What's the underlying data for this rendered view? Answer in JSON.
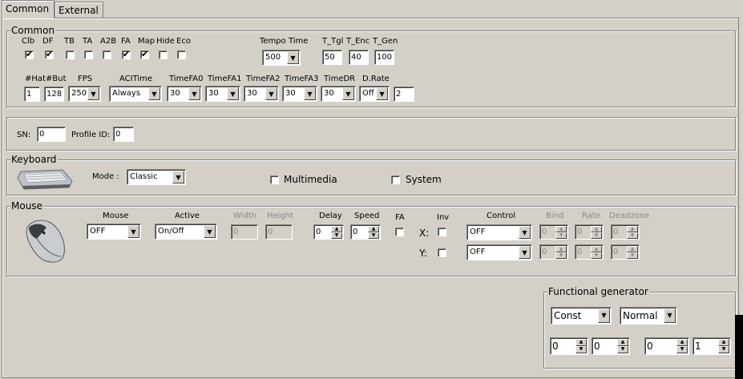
{
  "tabs": [
    {
      "label": "Common"
    },
    {
      "label": "External"
    }
  ],
  "common": {
    "legend": "Common",
    "checks": [
      {
        "label": "Clb",
        "checked": true
      },
      {
        "label": "DF",
        "checked": true
      },
      {
        "label": "TB",
        "checked": false
      },
      {
        "label": "TA",
        "checked": false
      },
      {
        "label": "A2B",
        "checked": false
      },
      {
        "label": "FA",
        "checked": true
      },
      {
        "label": "Map",
        "checked": true
      },
      {
        "label": "Hide",
        "checked": false
      },
      {
        "label": "Eco",
        "checked": false
      }
    ],
    "tempo_time_label": "Tempo Time",
    "tempo_time_value": "500",
    "t_tgl_label": "T_Tgl",
    "t_tgl_value": "50",
    "t_enc_label": "T_Enc",
    "t_enc_value": "40",
    "t_gen_label": "T_Gen",
    "t_gen_value": "100",
    "hat_label": "#Hat",
    "hat_value": "1",
    "but_label": "#But",
    "but_value": "128",
    "fps_label": "FPS",
    "fps_value": "250",
    "acitime_label": "ACITime",
    "acitime_value": "Always",
    "timefa0_label": "TimeFA0",
    "timefa0_value": "30",
    "timefa1_label": "TimeFA1",
    "timefa1_value": "30",
    "timefa2_label": "TimeFA2",
    "timefa2_value": "30",
    "timefa3_label": "TimeFA3",
    "timefa3_value": "30",
    "timedr_label": "TimeDR",
    "timedr_value": "30",
    "drate_label": "D.Rate",
    "drate_value": "Off",
    "drate_num": "2"
  },
  "sn": {
    "sn_label": "SN:",
    "sn_value": "0",
    "profile_label": "Profile ID:",
    "profile_value": "0"
  },
  "keyboard": {
    "legend": "Keyboard",
    "mode_label": "Mode :",
    "mode_value": "Classic",
    "multimedia_label": "Multimedia",
    "system_label": "System"
  },
  "mouse": {
    "legend": "Mouse",
    "mouse_label": "Mouse",
    "mouse_value": "OFF",
    "active_label": "Active",
    "active_value": "On/Off",
    "width_label": "Width",
    "width_value": "0",
    "height_label": "Height",
    "height_value": "0",
    "delay_label": "Delay",
    "delay_value": "0",
    "speed_label": "Speed",
    "speed_value": "0",
    "fa_label": "FA",
    "inv_label": "Inv",
    "x_label": "X:",
    "y_label": "Y:",
    "control_label": "Control",
    "control_x": "OFF",
    "control_y": "OFF",
    "bind_label": "Bind",
    "rate_label": "Rate",
    "deadzone_label": "Deadzone",
    "bind_x": "0",
    "rate_x": "0",
    "deadzone_x": "0",
    "bind_y": "0",
    "rate_y": "0",
    "deadzone_y": "0"
  },
  "functional_generator": {
    "legend": "Functional generator",
    "type_value": "Const",
    "mode_value": "Normal",
    "values": [
      "0",
      "0",
      "0",
      "1"
    ]
  }
}
